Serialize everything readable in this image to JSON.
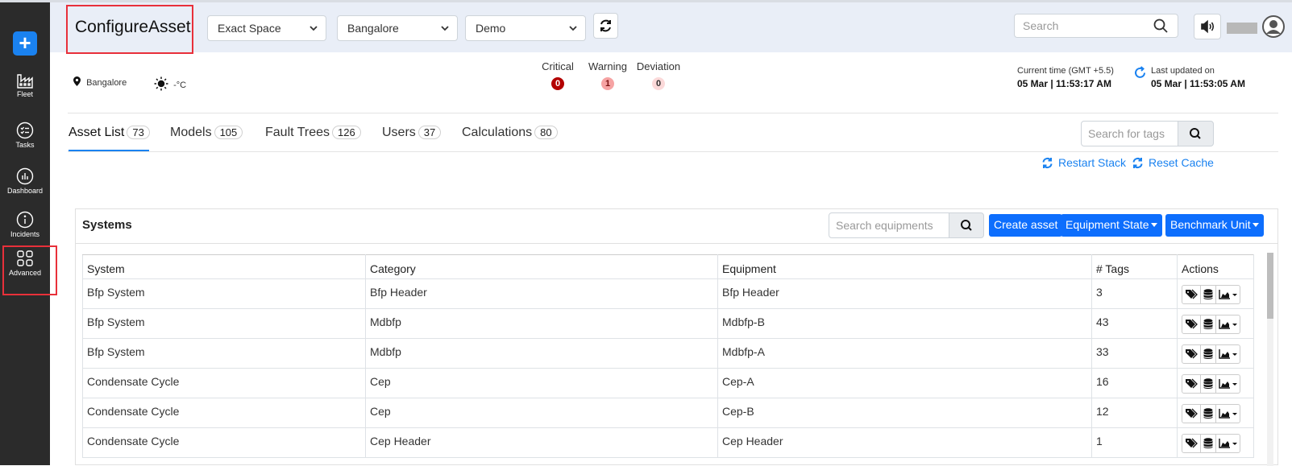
{
  "app": {
    "title": "ConfigureAsset"
  },
  "sidebar": {
    "items": [
      {
        "label": "Fleet",
        "icon": "factory-icon"
      },
      {
        "label": "Tasks",
        "icon": "checklist-icon"
      },
      {
        "label": "Dashboard",
        "icon": "bar-chart-icon"
      },
      {
        "label": "Incidents",
        "icon": "info-icon"
      },
      {
        "label": "Advanced",
        "icon": "grid-icon"
      }
    ]
  },
  "header": {
    "selects": {
      "company": "Exact Space",
      "site": "Bangalore",
      "unit": "Demo"
    },
    "search_placeholder": "Search"
  },
  "status": {
    "location": "Bangalore",
    "temperature": "-°C",
    "critical_label": "Critical",
    "critical_count": "0",
    "warning_label": "Warning",
    "warning_count": "1",
    "deviation_label": "Deviation",
    "deviation_count": "0",
    "current_time_label": "Current time (GMT +5.5)",
    "current_time_value": "05 Mar | 11:53:17 AM",
    "last_updated_label": "Last updated on",
    "last_updated_value": "05 Mar | 11:53:05 AM"
  },
  "tabs": [
    {
      "label": "Asset List",
      "count": "73",
      "active": true
    },
    {
      "label": "Models",
      "count": "105"
    },
    {
      "label": "Fault Trees",
      "count": "126"
    },
    {
      "label": "Users",
      "count": "37"
    },
    {
      "label": "Calculations",
      "count": "80"
    }
  ],
  "tag_search_placeholder": "Search for tags",
  "links": {
    "restart": "Restart Stack",
    "reset": "Reset Cache"
  },
  "systems": {
    "title": "Systems",
    "search_placeholder": "Search equipments",
    "create_label": "Create asset",
    "state_label": "Equipment State",
    "benchmark_label": "Benchmark Unit",
    "columns": [
      "System",
      "Category",
      "Equipment",
      "# Tags",
      "Actions"
    ],
    "rows": [
      {
        "system": "Bfp System",
        "category": "Bfp Header",
        "equipment": "Bfp Header",
        "tags": "3"
      },
      {
        "system": "Bfp System",
        "category": "Mdbfp",
        "equipment": "Mdbfp-B",
        "tags": "43"
      },
      {
        "system": "Bfp System",
        "category": "Mdbfp",
        "equipment": "Mdbfp-A",
        "tags": "33"
      },
      {
        "system": "Condensate Cycle",
        "category": "Cep",
        "equipment": "Cep-A",
        "tags": "16"
      },
      {
        "system": "Condensate Cycle",
        "category": "Cep",
        "equipment": "Cep-B",
        "tags": "12"
      },
      {
        "system": "Condensate Cycle",
        "category": "Cep Header",
        "equipment": "Cep Header",
        "tags": "1"
      }
    ]
  },
  "colors": {
    "accent": "#1a82f0",
    "primary_button": "#0d6efd",
    "highlight": "#e8303a",
    "sidebar": "#2b2b2b"
  }
}
